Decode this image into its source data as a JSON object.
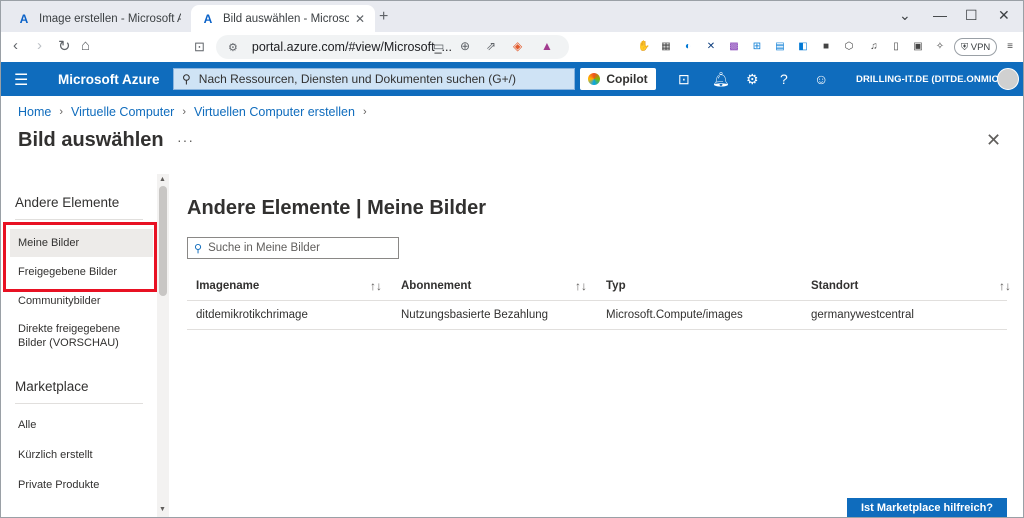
{
  "browser": {
    "tabs": [
      {
        "title": "Image erstellen - Microsoft Azure"
      },
      {
        "title": "Bild auswählen - Microsoft Azure"
      }
    ],
    "url": "portal.azure.com/#view/Microsoft_..."
  },
  "azure": {
    "brand": "Microsoft Azure",
    "search_placeholder": "Nach Ressourcen, Diensten und Dokumenten suchen (G+/)",
    "copilot_label": "Copilot",
    "tenant": "DRILLING-IT.DE (DITDE.ONMICR..."
  },
  "breadcrumb": [
    {
      "label": "Home"
    },
    {
      "label": "Virtuelle Computer"
    },
    {
      "label": "Virtuellen Computer erstellen"
    }
  ],
  "page_title": "Bild auswählen",
  "more_label": "···",
  "left_menu": {
    "section1": "Andere Elemente",
    "items1": [
      {
        "label": "Meine Bilder"
      },
      {
        "label": "Freigegebene Bilder"
      },
      {
        "label": "Communitybilder"
      },
      {
        "label": "Direkte freigegebene Bilder (VORSCHAU)"
      }
    ],
    "section2": "Marketplace",
    "items2": [
      {
        "label": "Alle"
      },
      {
        "label": "Kürzlich erstellt"
      },
      {
        "label": "Private Produkte"
      }
    ]
  },
  "main": {
    "heading": "Andere Elemente | Meine Bilder",
    "filter_placeholder": "Suche in Meine Bilder",
    "columns": [
      "Imagename",
      "Abonnement",
      "Typ",
      "Standort"
    ],
    "rows": [
      [
        "ditdemikrotikchrimage",
        "Nutzungsbasierte Bezahlung",
        "Microsoft.Compute/images",
        "germanywestcentral"
      ]
    ]
  },
  "marketplace_feedback": "Ist Marketplace hilfreich?",
  "colors": {
    "azure_blue": "#0f6cbd",
    "highlight_red": "#e81123"
  }
}
